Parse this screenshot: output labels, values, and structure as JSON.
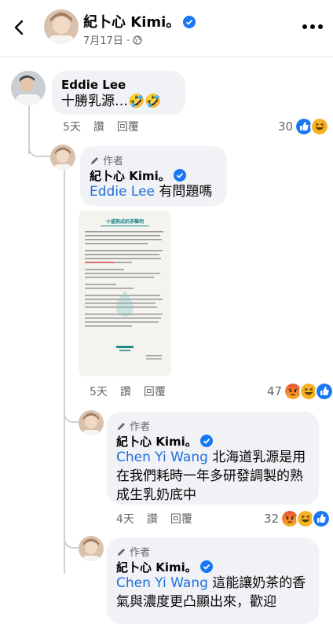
{
  "header": {
    "page_name": "紀卜心 Kimi。",
    "post_date": "7月17日 ·",
    "accent": "#1877f2"
  },
  "comments": [
    {
      "author": "Eddie Lee",
      "text": "十勝乳源…🤣🤣",
      "time": "5天",
      "like": "讚",
      "reply": "回覆",
      "reaction_count": "30",
      "reactions": [
        "like-icon",
        "haha-icon"
      ]
    },
    {
      "role": "作者",
      "author": "紀卜心 Kimi。",
      "mention": "Eddie Lee",
      "text": " 有問題嗎",
      "attachment_title": "十盛熟成奶茶聲明",
      "time": "5天",
      "like": "讚",
      "reply": "回覆",
      "reaction_count": "47",
      "reactions": [
        "angry-icon",
        "haha-icon",
        "like-icon"
      ]
    },
    {
      "role": "作者",
      "author": "紀卜心 Kimi。",
      "mention": "Chen Yi Wang",
      "text": " 北海道乳源是用在我們耗時一年多研發調製的熟成生乳奶底中",
      "time": "4天",
      "like": "讚",
      "reply": "回覆",
      "reaction_count": "32",
      "reactions": [
        "angry-icon",
        "haha-icon",
        "like-icon"
      ]
    },
    {
      "role": "作者",
      "author": "紀卜心 Kimi。",
      "mention": "Chen Yi Wang",
      "text": " 這能讓奶茶的香氣與濃度更凸顯出來，歡迎"
    }
  ]
}
